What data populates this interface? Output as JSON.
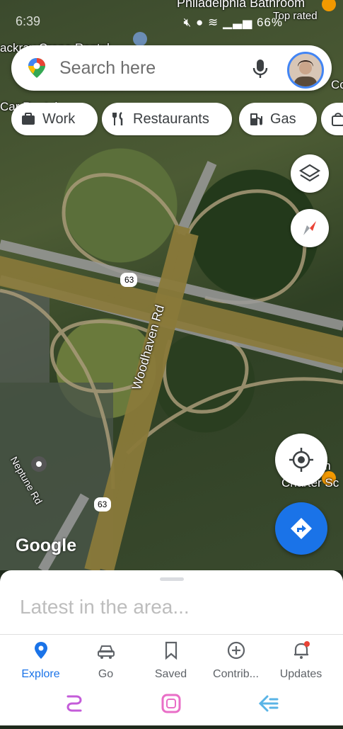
{
  "status_bar": {
    "time": "6:39",
    "battery": "66%"
  },
  "map_labels": {
    "top_business": "Philadelphia Bathroom",
    "top_rated": "Top rated",
    "left_business_1": "ackray Crane Rental",
    "left_business_2": "Car Rental",
    "road_name": "Woodhaven Rd",
    "route_shield_1": "63",
    "route_shield_2": "63",
    "street_name": "Neptune Rd",
    "right_business": "Charter Sc",
    "right_business_2": "om",
    "right_edge": "Co"
  },
  "search": {
    "placeholder": "Search here"
  },
  "chips": [
    {
      "label": "Work",
      "icon": "briefcase-icon"
    },
    {
      "label": "Restaurants",
      "icon": "fork-knife-icon"
    },
    {
      "label": "Gas",
      "icon": "gas-pump-icon"
    },
    {
      "label": "",
      "icon": "shopping-bag-icon"
    }
  ],
  "google_logo": "Google",
  "sheet": {
    "title": "Latest in the area..."
  },
  "bottom_nav": [
    {
      "label": "Explore",
      "icon": "explore-pin-icon",
      "active": true
    },
    {
      "label": "Go",
      "icon": "car-icon",
      "active": false
    },
    {
      "label": "Saved",
      "icon": "bookmark-icon",
      "active": false
    },
    {
      "label": "Contrib...",
      "icon": "add-circle-icon",
      "active": false
    },
    {
      "label": "Updates",
      "icon": "bell-icon",
      "active": false
    }
  ],
  "colors": {
    "accent": "#1a73e8",
    "road": "#8a7a3a",
    "notification_dot": "#ea4335"
  }
}
